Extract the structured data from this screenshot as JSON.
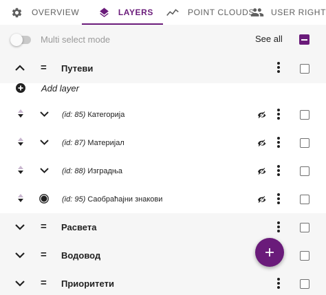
{
  "colors": {
    "accent": "#6a1b7a",
    "group_bg": "#f6f6f6",
    "text": "#212121",
    "muted": "#9a9a9a"
  },
  "tabs": [
    {
      "label": "OVERVIEW",
      "icon": "gear-icon",
      "active": false
    },
    {
      "label": "LAYERS",
      "icon": "layers-icon",
      "active": true
    },
    {
      "label": "POINT CLOUDS",
      "icon": "line-chart-icon",
      "active": false
    },
    {
      "label": "USER RIGHTS",
      "icon": "people-icon",
      "active": false
    }
  ],
  "toolbar": {
    "multi_select_label": "Multi select mode",
    "multi_select_on": false,
    "see_all_label": "See all",
    "master_checkbox": "indeterminate"
  },
  "groups": {
    "g1": {
      "eq": "=",
      "title": "Путеви",
      "expanded": true
    },
    "g2": {
      "eq": "=",
      "title": "Расвета",
      "expanded": false
    },
    "g3": {
      "eq": "=",
      "title": "Водовод",
      "expanded": false
    },
    "g4": {
      "eq": "=",
      "title": "Приоритети",
      "expanded": false
    }
  },
  "add_layer_label": "Add layer",
  "layers": [
    {
      "id_label": "(id: 85)",
      "name": "Категорија",
      "type": "group",
      "visibility_icon": "eye-off-icon"
    },
    {
      "id_label": "(id: 87)",
      "name": "Материјал",
      "type": "group",
      "visibility_icon": "eye-off-icon"
    },
    {
      "id_label": "(id: 88)",
      "name": "Изградња",
      "type": "group",
      "visibility_icon": "eye-off-icon"
    },
    {
      "id_label": "(id: 95)",
      "name": "Саобраћајни знакови",
      "type": "point",
      "visibility_icon": "eye-off-icon"
    }
  ],
  "fab": {
    "icon": "plus-icon"
  }
}
